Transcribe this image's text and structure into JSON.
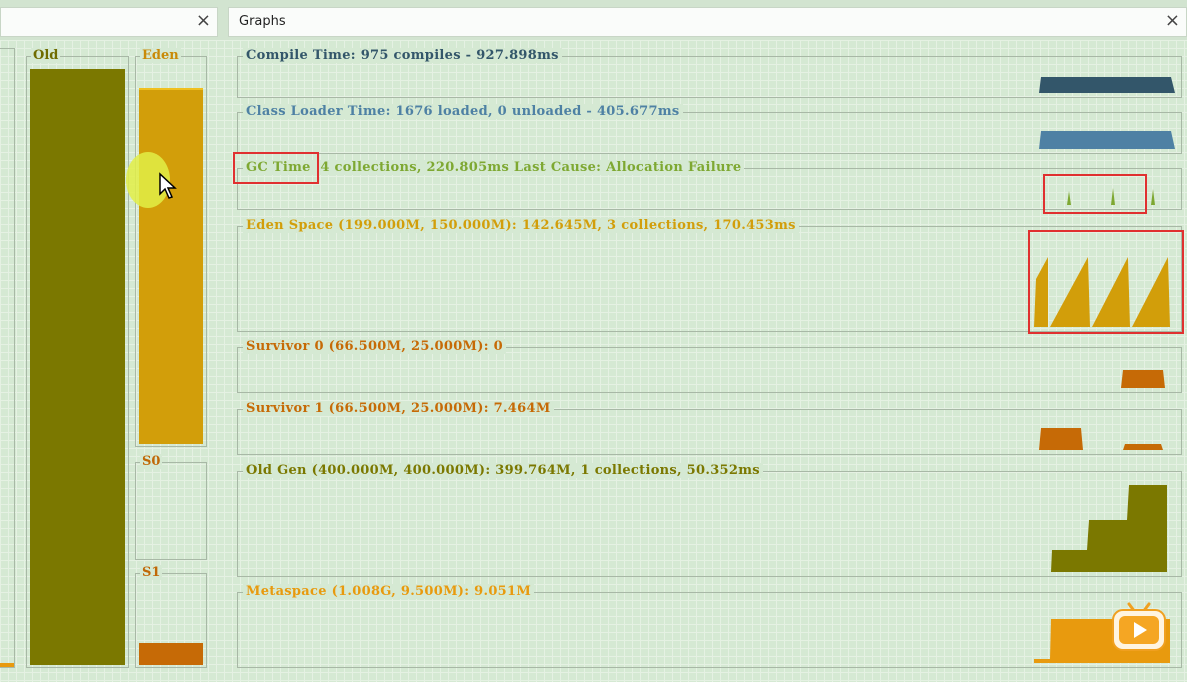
{
  "tabs": [
    {
      "title": "",
      "close": "×"
    },
    {
      "title": "Graphs",
      "close": "×"
    }
  ],
  "left_panel": {
    "old_label": "Old",
    "eden_label": "Eden",
    "s0_label": "S0",
    "s1_label": "S1",
    "old_fill": 1.0,
    "eden_fill": 1.0,
    "s0_fill": 0,
    "s1_fill": 0.11
  },
  "graphs": {
    "compile": "Compile Time: 975 compiles - 927.898ms",
    "classloader": "Class Loader Time: 1676 loaded, 0 unloaded - 405.677ms",
    "gc_label": "GC Time",
    "gc_rest": "4 collections, 220.805ms Last Cause: Allocation Failure",
    "eden": "Eden Space (199.000M, 150.000M): 142.645M, 3 collections, 170.453ms",
    "survivor0": "Survivor 0 (66.500M, 25.000M): 0",
    "survivor1": "Survivor 1 (66.500M, 25.000M): 7.464M",
    "oldgen": "Old Gen (400.000M, 400.000M): 399.764M, 1 collections, 50.352ms",
    "metaspace": "Metaspace (1.008G, 9.500M): 9.051M"
  },
  "colors": {
    "compile": "#33566a",
    "classloader": "#4e81a4",
    "gc": "#7ea832",
    "eden": "#d29e0a",
    "survivor": "#c66a06",
    "old": "#7b7800",
    "metaspace": "#e89a0e",
    "highlight": "#e03030"
  }
}
